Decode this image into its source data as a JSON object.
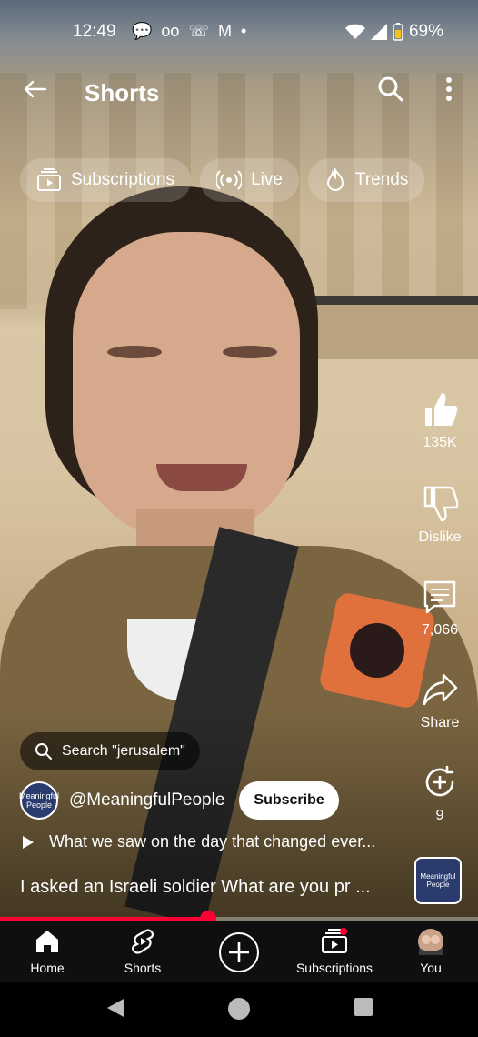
{
  "status_bar": {
    "time": "12:49",
    "battery": "69%",
    "left_icons": [
      "message-icon",
      "voicemail-icon",
      "missed-call-icon",
      "gmail-icon",
      "dot-icon"
    ],
    "right_icons": [
      "wifi-icon",
      "signal-icon",
      "battery-icon"
    ]
  },
  "header": {
    "title": "Shorts"
  },
  "chips": [
    {
      "label": "Subscriptions",
      "icon": "subscriptions-icon"
    },
    {
      "label": "Live",
      "icon": "live-icon"
    },
    {
      "label": "Trends",
      "icon": "trends-icon"
    }
  ],
  "actions": {
    "like_count": "135K",
    "dislike_label": "Dislike",
    "comment_count": "7,066",
    "share_label": "Share",
    "remix_count": "9"
  },
  "search_pill": {
    "label": "Search \"jerusalem\""
  },
  "channel": {
    "handle": "@MeaningfulPeople",
    "subscribe_label": "Subscribe",
    "avatar_text": "Meaningful People"
  },
  "playlist": {
    "title": "What we saw on the day that changed ever..."
  },
  "caption": "I asked an Israeli soldier What are you pr ...",
  "sound_thumb_text": "Meaningful People",
  "progress": {
    "fraction": 0.435,
    "color": "#ff0033"
  },
  "bottom_nav": [
    {
      "label": "Home",
      "icon": "home-icon"
    },
    {
      "label": "Shorts",
      "icon": "shorts-icon"
    },
    {
      "label": "",
      "icon": "create-plus-icon"
    },
    {
      "label": "Subscriptions",
      "icon": "subscriptions-icon"
    },
    {
      "label": "You",
      "icon": "profile-avatar-icon"
    }
  ]
}
